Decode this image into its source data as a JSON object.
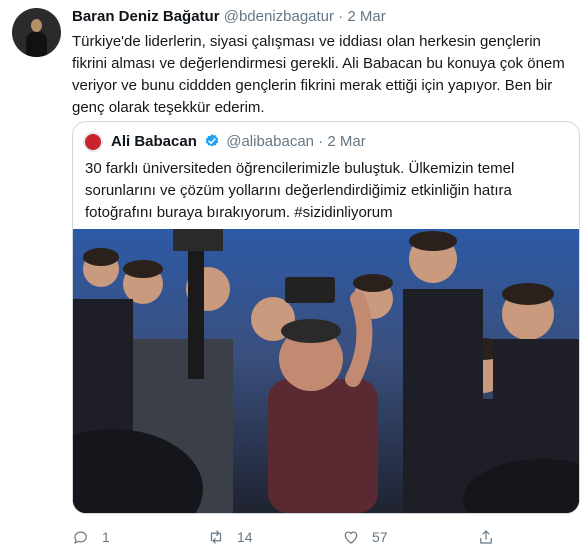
{
  "author": {
    "name": "Baran Deniz Bağatur",
    "handle": "@bdenizbagatur",
    "separator": "·",
    "date": "2 Mar"
  },
  "tweet_text": "Türkiye'de liderlerin, siyasi çalışması ve iddiası olan herkesin gençlerin fikrini alması ve değerlendirmesi gerekli. Ali Babacan bu konuya çok önem veriyor ve bunu ciddden gençlerin fikrini merak ettiği için yapıyor. Ben bir genç olarak teşekkür ederim.",
  "quoted": {
    "name": "Ali Babacan",
    "handle": "@alibabacan",
    "separator": "·",
    "date": "2 Mar",
    "text": "30 farklı üniversiteden öğrencilerimizle buluştuk. Ülkemizin temel sorunlarını ve çözüm yollarını değerlendirdiğimiz etkinliğin hatıra fotoğrafını buraya bırakıyorum. #sizidinliyorum"
  },
  "actions": {
    "reply_count": "1",
    "retweet_count": "14",
    "like_count": "57",
    "icons": [
      "reply-icon",
      "retweet-icon",
      "like-icon",
      "share-icon"
    ]
  },
  "colors": {
    "secondary_text": "#657786",
    "verified_blue": "#1da1f2",
    "border": "#cfd9de"
  }
}
